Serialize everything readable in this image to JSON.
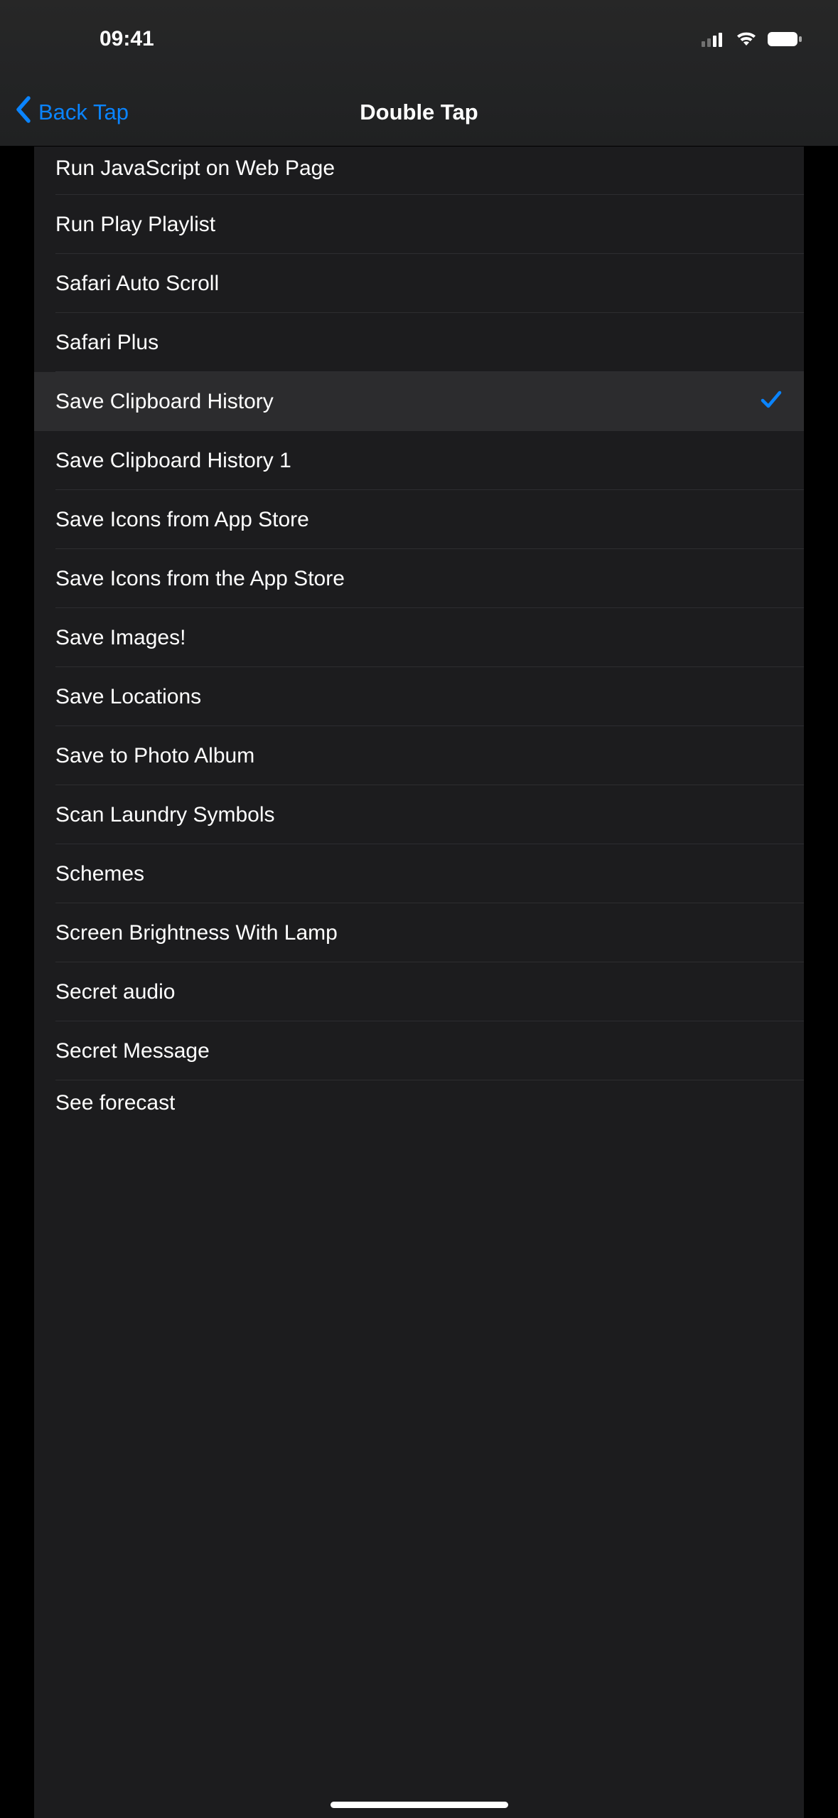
{
  "status": {
    "time": "09:41"
  },
  "nav": {
    "back_label": "Back Tap",
    "title": "Double Tap"
  },
  "list": {
    "items": [
      {
        "label": "Run JavaScript on Web Page",
        "selected": false
      },
      {
        "label": "Run Play Playlist",
        "selected": false
      },
      {
        "label": "Safari Auto Scroll",
        "selected": false
      },
      {
        "label": "Safari Plus",
        "selected": false
      },
      {
        "label": "Save Clipboard History",
        "selected": true
      },
      {
        "label": "Save Clipboard History 1",
        "selected": false
      },
      {
        "label": "Save Icons from App Store",
        "selected": false
      },
      {
        "label": "Save Icons from the App Store",
        "selected": false
      },
      {
        "label": "Save Images!",
        "selected": false
      },
      {
        "label": "Save Locations",
        "selected": false
      },
      {
        "label": "Save to Photo Album",
        "selected": false
      },
      {
        "label": "Scan Laundry Symbols",
        "selected": false
      },
      {
        "label": "Schemes",
        "selected": false
      },
      {
        "label": "Screen Brightness With Lamp",
        "selected": false
      },
      {
        "label": "Secret audio",
        "selected": false
      },
      {
        "label": "Secret Message",
        "selected": false
      },
      {
        "label": "See forecast",
        "selected": false
      }
    ]
  }
}
